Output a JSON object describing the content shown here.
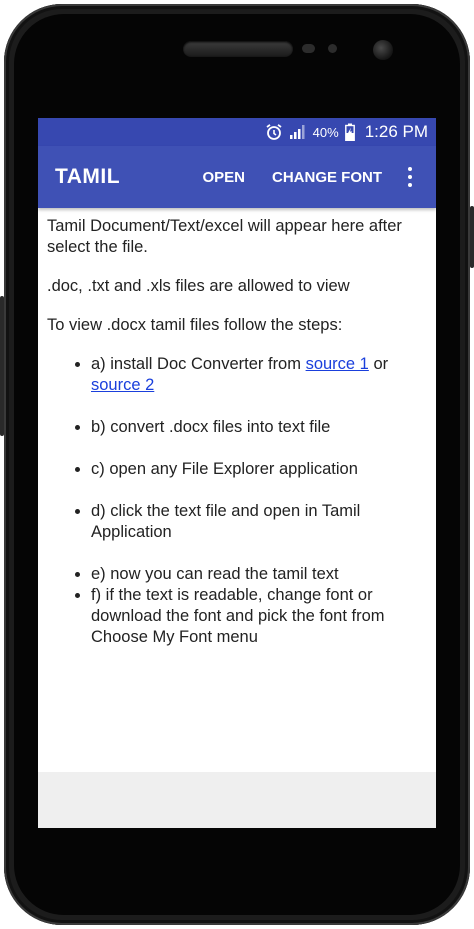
{
  "status_bar": {
    "battery": "40%",
    "time": "1:26 PM",
    "icons": [
      "alarm-icon",
      "signal-icon",
      "battery-charging-icon"
    ]
  },
  "app_bar": {
    "title": "TAMIL",
    "open_label": "OPEN",
    "change_font_label": "CHANGE FONT",
    "overflow_icon": "more-vert-icon"
  },
  "content": {
    "intro": "Tamil Document/Text/excel will appear here after select the file.",
    "allowed": ".doc, .txt and .xls files are allowed to view",
    "steps_heading": "To view .docx tamil files follow the steps:",
    "steps": {
      "a_prefix": "a) install Doc Converter from ",
      "a_link1": "source 1",
      "a_mid": " or ",
      "a_link2": "source 2",
      "b": "b) convert .docx files into text file",
      "c": "c) open any File Explorer application",
      "d": "d) click the text file and open in Tamil Application",
      "e": "e) now you can read the tamil text",
      "f": "f) if the text is readable, change font or download the font and pick the font from Choose My Font menu"
    }
  },
  "colors": {
    "status_bar": "#3748b0",
    "app_bar": "#3f51b5",
    "link": "#1a3fdc",
    "bottom_area": "#efefef"
  }
}
